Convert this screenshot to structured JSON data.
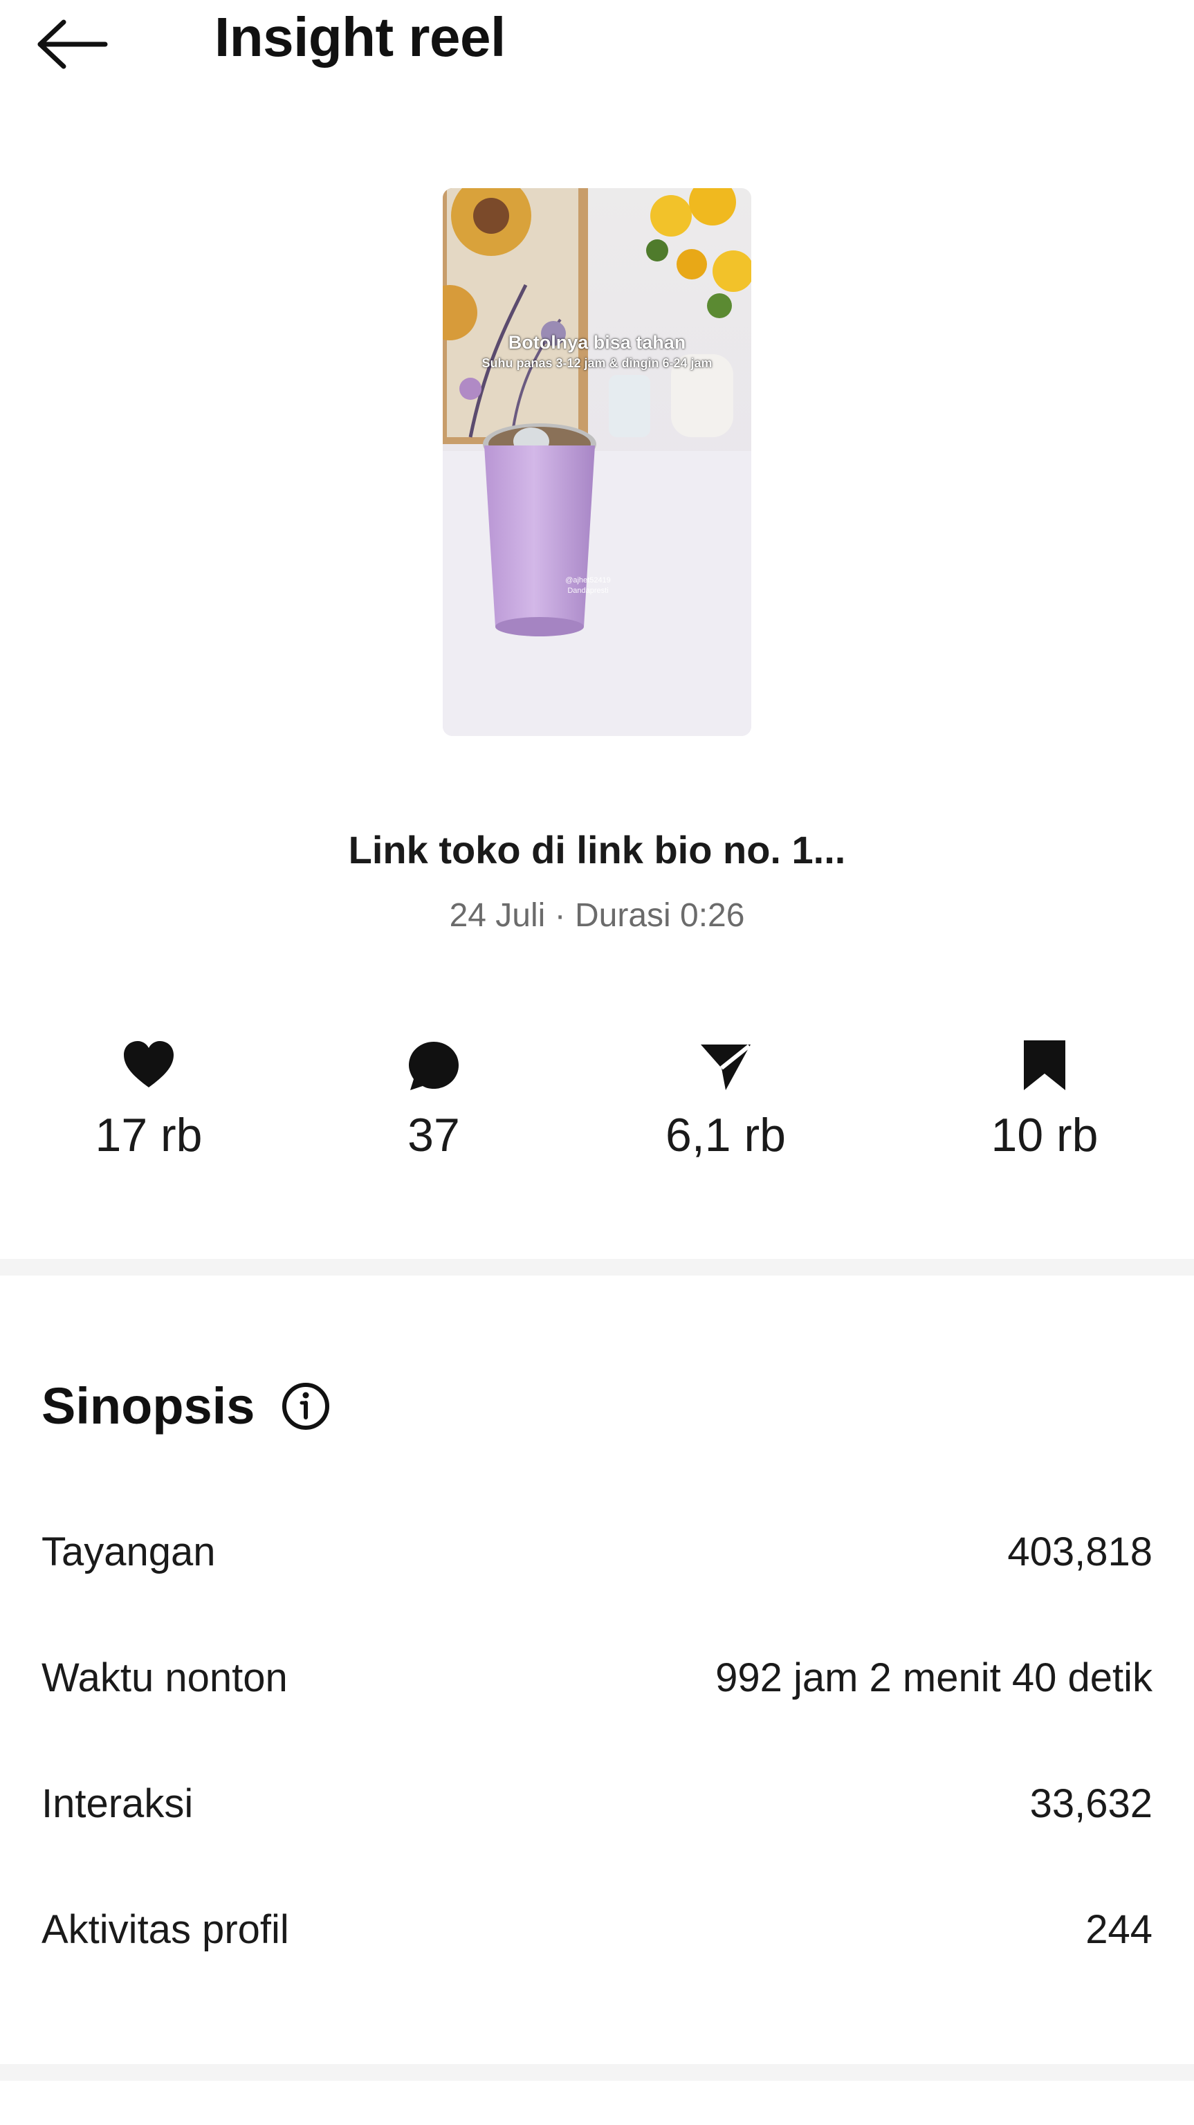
{
  "header": {
    "title": "Insight reel",
    "back_icon": "arrow-left-icon"
  },
  "thumbnail": {
    "caption_line1": "Botolnya bisa tahan",
    "caption_line2": "Suhu panas 3-12 jam & dingin 6-24 jam",
    "watermark_line1": "@ajhet52419",
    "watermark_line2": "Dandapresti"
  },
  "reel": {
    "title": "Link toko di link bio no. 1...",
    "meta": "24 Juli · Durasi 0:26"
  },
  "stats": {
    "likes": {
      "icon": "heart-icon",
      "value": "17 rb"
    },
    "comments": {
      "icon": "comment-icon",
      "value": "37"
    },
    "shares": {
      "icon": "send-icon",
      "value": "6,1 rb"
    },
    "saves": {
      "icon": "bookmark-icon",
      "value": "10 rb"
    }
  },
  "synopsis": {
    "title": "Sinopsis",
    "info_icon": "info-icon",
    "rows": [
      {
        "label": "Tayangan",
        "value": "403,818"
      },
      {
        "label": "Waktu nonton",
        "value": "992 jam 2 menit 40 detik"
      },
      {
        "label": "Interaksi",
        "value": "33,632"
      },
      {
        "label": "Aktivitas profil",
        "value": "244"
      }
    ]
  },
  "colors": {
    "text": "#111111",
    "muted": "#6b6b6b",
    "divider": "#f4f4f4",
    "tumbler": "#c8a6df"
  }
}
